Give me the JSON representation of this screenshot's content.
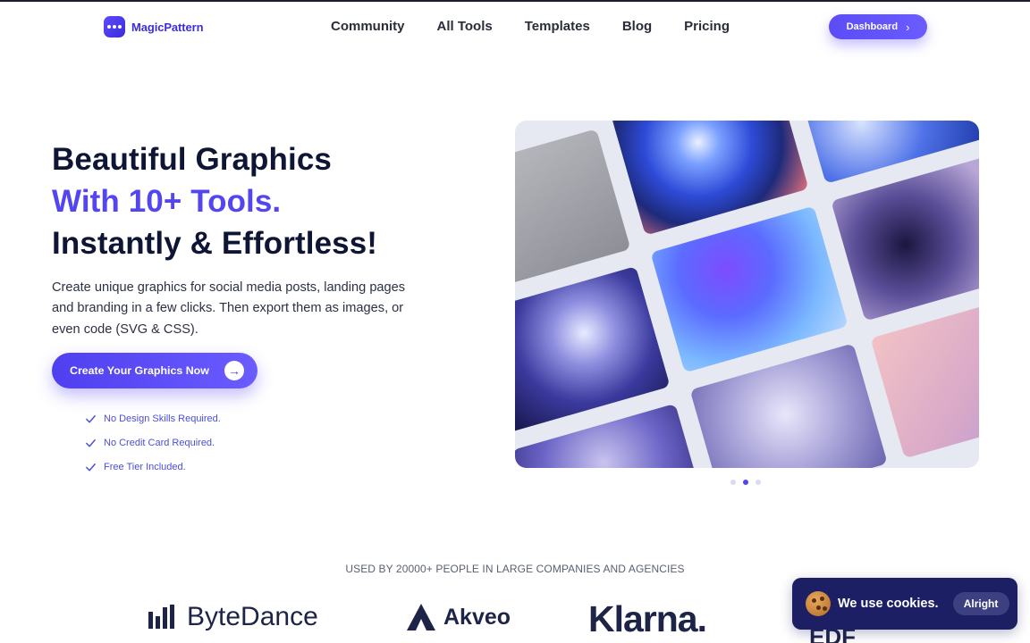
{
  "nav": {
    "brand": "MagicPattern",
    "links": [
      "Community",
      "All Tools",
      "Templates",
      "Blog",
      "Pricing"
    ],
    "dashboard_label": "Dashboard"
  },
  "hero": {
    "line1": "Beautiful Graphics",
    "line2": "With 10+ Tools.",
    "line3": "Instantly & Effortless!",
    "description": "Create unique graphics for social media posts, landing pages and branding in a few clicks. Then export them as images, or even code (SVG & CSS).",
    "cta_label": "Create Your Graphics Now",
    "checks": [
      "No Design Skills Required.",
      "No Credit Card Required.",
      "Free Tier Included."
    ],
    "carousel_active_index": 1,
    "carousel_count": 3
  },
  "social_proof": {
    "heading": "USED BY 20000+ PEOPLE IN LARGE COMPANIES AND AGENCIES",
    "companies": [
      "ByteDance",
      "Akveo",
      "Klarna.",
      "EDF"
    ]
  },
  "cookie": {
    "text": "We use cookies.",
    "button": "Alright"
  },
  "colors": {
    "accent": "#5346f0",
    "heading": "#0f1535",
    "cookie_bg": "#1c1f63"
  }
}
